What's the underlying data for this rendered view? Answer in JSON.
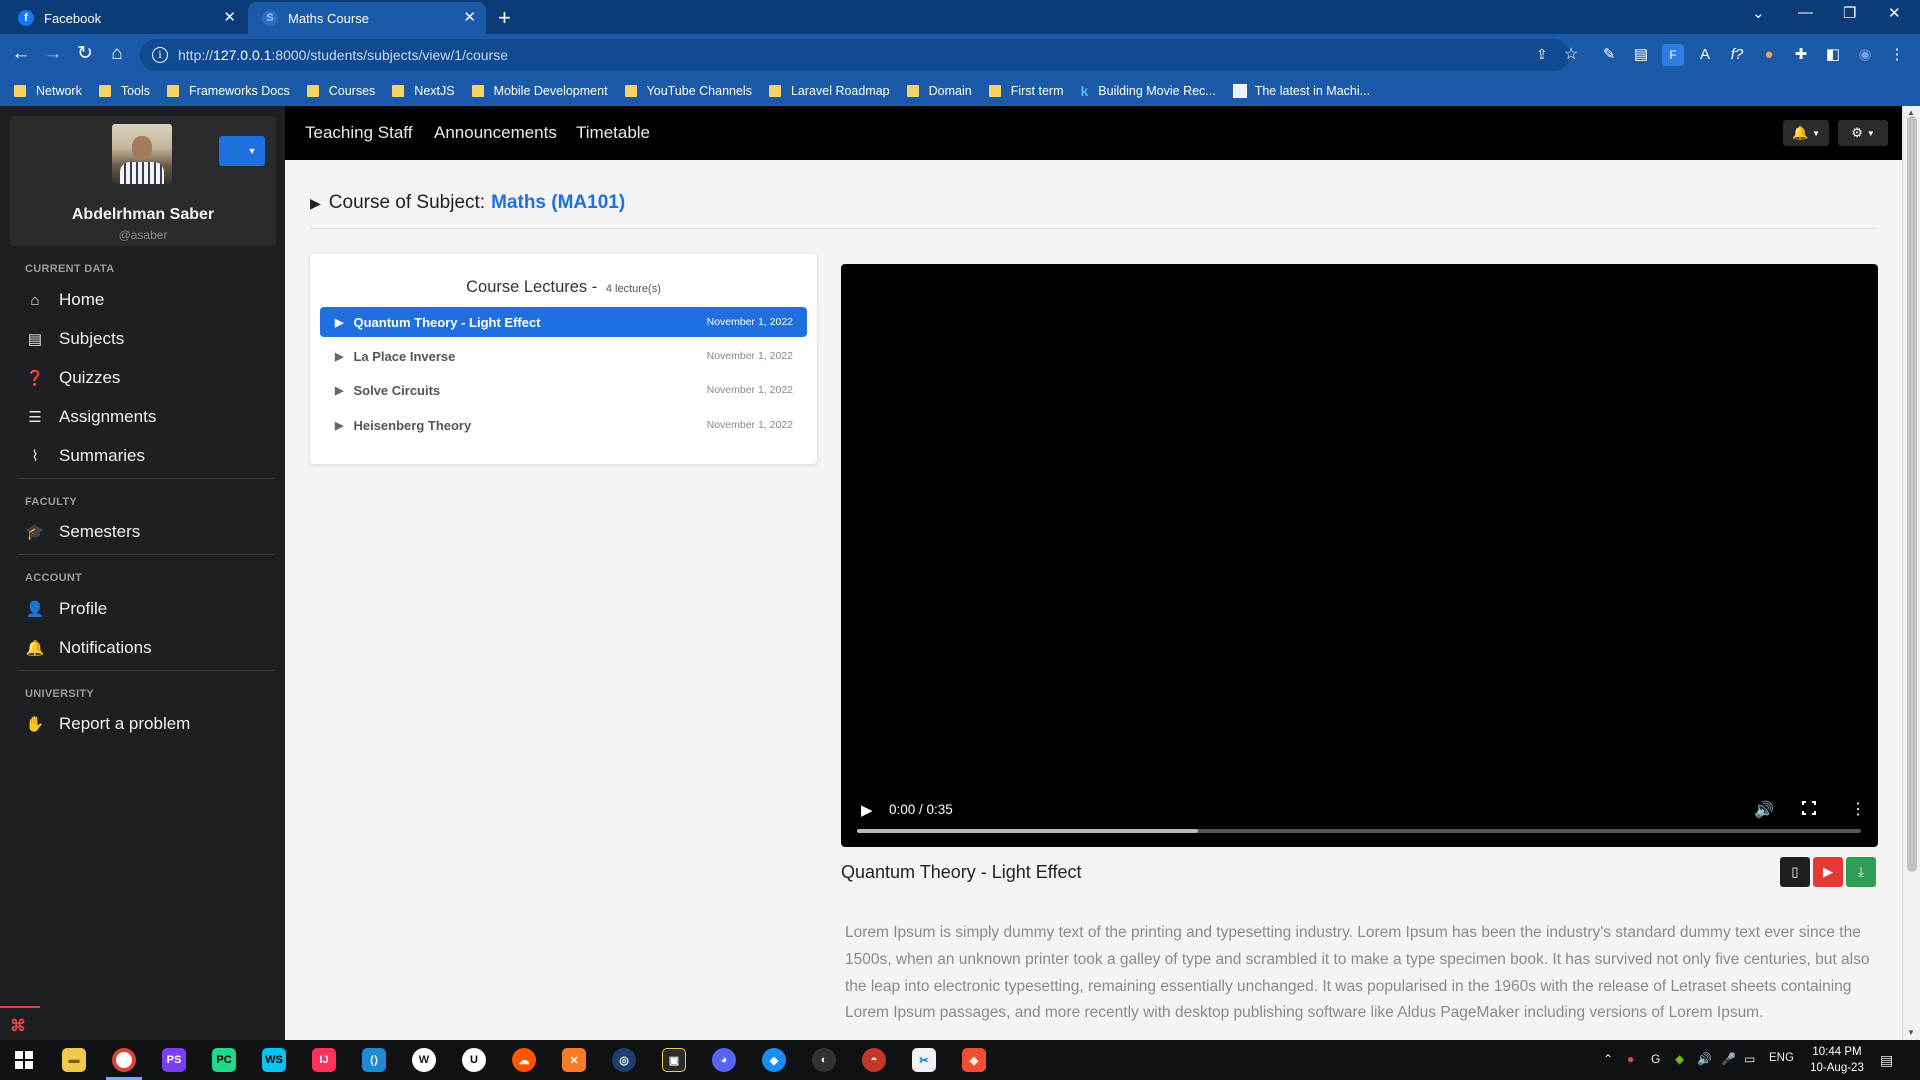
{
  "browser": {
    "tabs": [
      {
        "title": "Facebook",
        "icon": "facebook-icon",
        "active": false
      },
      {
        "title": "Maths Course",
        "icon": "site-icon",
        "active": true
      }
    ],
    "url_host": "127.0.0.1",
    "url_prefix": "http://",
    "url_path": ":8000/students/subjects/view/1/course",
    "bookmarks": [
      {
        "label": "Network",
        "icon": "folder-icon"
      },
      {
        "label": "Tools",
        "icon": "folder-icon"
      },
      {
        "label": "Frameworks Docs",
        "icon": "folder-icon"
      },
      {
        "label": "Courses",
        "icon": "folder-icon"
      },
      {
        "label": "NextJS",
        "icon": "folder-icon"
      },
      {
        "label": "Mobile Development",
        "icon": "folder-icon"
      },
      {
        "label": "YouTube Channels",
        "icon": "folder-icon"
      },
      {
        "label": "Laravel Roadmap",
        "icon": "folder-icon"
      },
      {
        "label": "Domain",
        "icon": "folder-icon"
      },
      {
        "label": "First term",
        "icon": "folder-icon"
      },
      {
        "label": "Building Movie Rec...",
        "icon": "kaggle-icon"
      },
      {
        "label": "The latest in Machi...",
        "icon": "page-icon"
      }
    ]
  },
  "sidebar": {
    "user": {
      "name": "Abdelrhman Saber",
      "handle": "@asaber"
    },
    "sections": {
      "current_data": "CURRENT DATA",
      "faculty": "FACULTY",
      "account": "ACCOUNT",
      "university": "UNIVERSITY"
    },
    "items": {
      "home": "Home",
      "subjects": "Subjects",
      "quizzes": "Quizzes",
      "assignments": "Assignments",
      "summaries": "Summaries",
      "semesters": "Semesters",
      "profile": "Profile",
      "notifications": "Notifications",
      "report": "Report a problem"
    }
  },
  "topnav": {
    "links": [
      "Teaching Staff",
      "Announcements",
      "Timetable"
    ]
  },
  "heading": {
    "prefix": "Course of Subject:",
    "subject": "Maths (MA101)"
  },
  "lectures": {
    "title": "Course Lectures -",
    "count": "4 lecture(s)",
    "items": [
      {
        "title": "Quantum Theory - Light Effect",
        "date": "November 1, 2022",
        "active": true
      },
      {
        "title": "La Place Inverse",
        "date": "November 1, 2022",
        "active": false
      },
      {
        "title": "Solve Circuits",
        "date": "November 1, 2022",
        "active": false
      },
      {
        "title": "Heisenberg Theory",
        "date": "November 1, 2022",
        "active": false
      }
    ]
  },
  "player": {
    "time": "0:00 / 0:35",
    "buffered_fraction": 0.34
  },
  "current_lecture": {
    "title": "Quantum Theory - Light Effect",
    "description": "Lorem Ipsum is simply dummy text of the printing and typesetting industry. Lorem Ipsum has been the industry's standard dummy text ever since the 1500s, when an unknown printer took a galley of type and scrambled it to make a type specimen book. It has survived not only five centuries, but also the leap into electronic typesetting, remaining essentially unchanged. It was popularised in the 1960s with the release of Letraset sheets containing Lorem Ipsum passages, and more recently with desktop publishing software like Aldus PageMaker including versions of Lorem Ipsum."
  },
  "taskbar": {
    "language": "ENG",
    "time": "10:44 PM",
    "date": "10-Aug-23"
  },
  "colors": {
    "accent": "#1f6fe0",
    "chrome": "#1b5aa8",
    "sidebar": "#1e1f22",
    "youtube": "#e53935",
    "download": "#2e9e57"
  }
}
